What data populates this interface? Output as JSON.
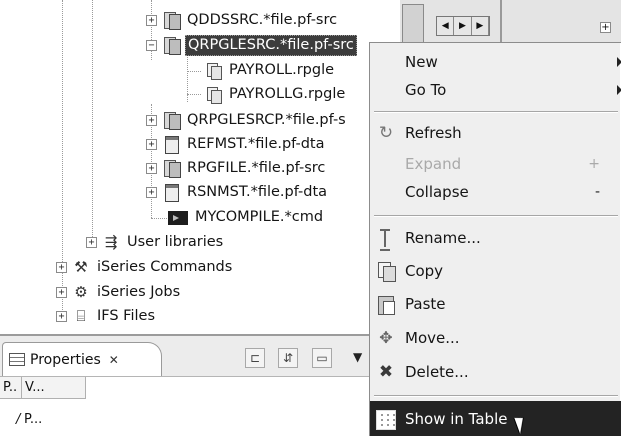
{
  "tree": {
    "items": [
      {
        "label": "QDDSSRC.*file.pf-src",
        "icon": "source-file-icon",
        "selected": false
      },
      {
        "label": "QRPGLESRC.*file.pf-src",
        "icon": "source-file-icon",
        "selected": true
      },
      {
        "label": "PAYROLL.rpgle",
        "icon": "member-icon",
        "selected": false
      },
      {
        "label": "PAYROLLG.rpgle",
        "icon": "member-icon",
        "selected": false
      },
      {
        "label": "QRPGLESRCP.*file.pf-s",
        "icon": "source-file-icon",
        "selected": false
      },
      {
        "label": "REFMST.*file.pf-dta",
        "icon": "data-file-icon",
        "selected": false
      },
      {
        "label": "RPGFILE.*file.pf-src",
        "icon": "source-file-icon",
        "selected": false
      },
      {
        "label": "RSNMST.*file.pf-dta",
        "icon": "data-file-icon",
        "selected": false
      },
      {
        "label": "MYCOMPILE.*cmd",
        "icon": "command-icon",
        "selected": false
      },
      {
        "label": "User libraries",
        "icon": "libraries-icon",
        "selected": false
      },
      {
        "label": "iSeries Commands",
        "icon": "commands-icon",
        "selected": false
      },
      {
        "label": "iSeries Jobs",
        "icon": "jobs-icon",
        "selected": false
      },
      {
        "label": "IFS Files",
        "icon": "ifs-files-icon",
        "selected": false
      }
    ],
    "expand_plus": "+",
    "expand_minus": "−"
  },
  "right_pane": {
    "scroll_left": "◀",
    "scroll_mid": "▶",
    "scroll_right": "▶",
    "plus": "+"
  },
  "properties": {
    "tab_title": "Properties",
    "tab_close": "✕",
    "toolbar_1": "⊏",
    "toolbar_2": "⇵",
    "toolbar_3": "▭",
    "menu_arrow": "▼",
    "col_1": "P..",
    "col_2": "V...",
    "cell_1": "/",
    "cell_2": "P..."
  },
  "context_menu": {
    "items": [
      {
        "label": "New",
        "submenu": true,
        "enabled": true
      },
      {
        "label": "Go To",
        "submenu": true,
        "enabled": true
      },
      {
        "label": "Refresh",
        "icon": "refresh-icon",
        "enabled": true
      },
      {
        "label": "Expand",
        "accelerator": "+",
        "enabled": false
      },
      {
        "label": "Collapse",
        "accelerator": "-",
        "enabled": true
      },
      {
        "label": "Rename...",
        "icon": "rename-icon",
        "enabled": true
      },
      {
        "label": "Copy",
        "icon": "copy-icon",
        "enabled": true
      },
      {
        "label": "Paste",
        "icon": "paste-icon",
        "enabled": true
      },
      {
        "label": "Move...",
        "icon": "move-icon",
        "enabled": true
      },
      {
        "label": "Delete...",
        "icon": "delete-icon",
        "enabled": true
      },
      {
        "label": "Show in Table",
        "icon": "table-icon",
        "enabled": true,
        "highlighted": true
      }
    ]
  },
  "colors": {
    "selection": "#3c3c3c",
    "menu_bg": "#efefef",
    "menu_highlight": "#232323"
  }
}
